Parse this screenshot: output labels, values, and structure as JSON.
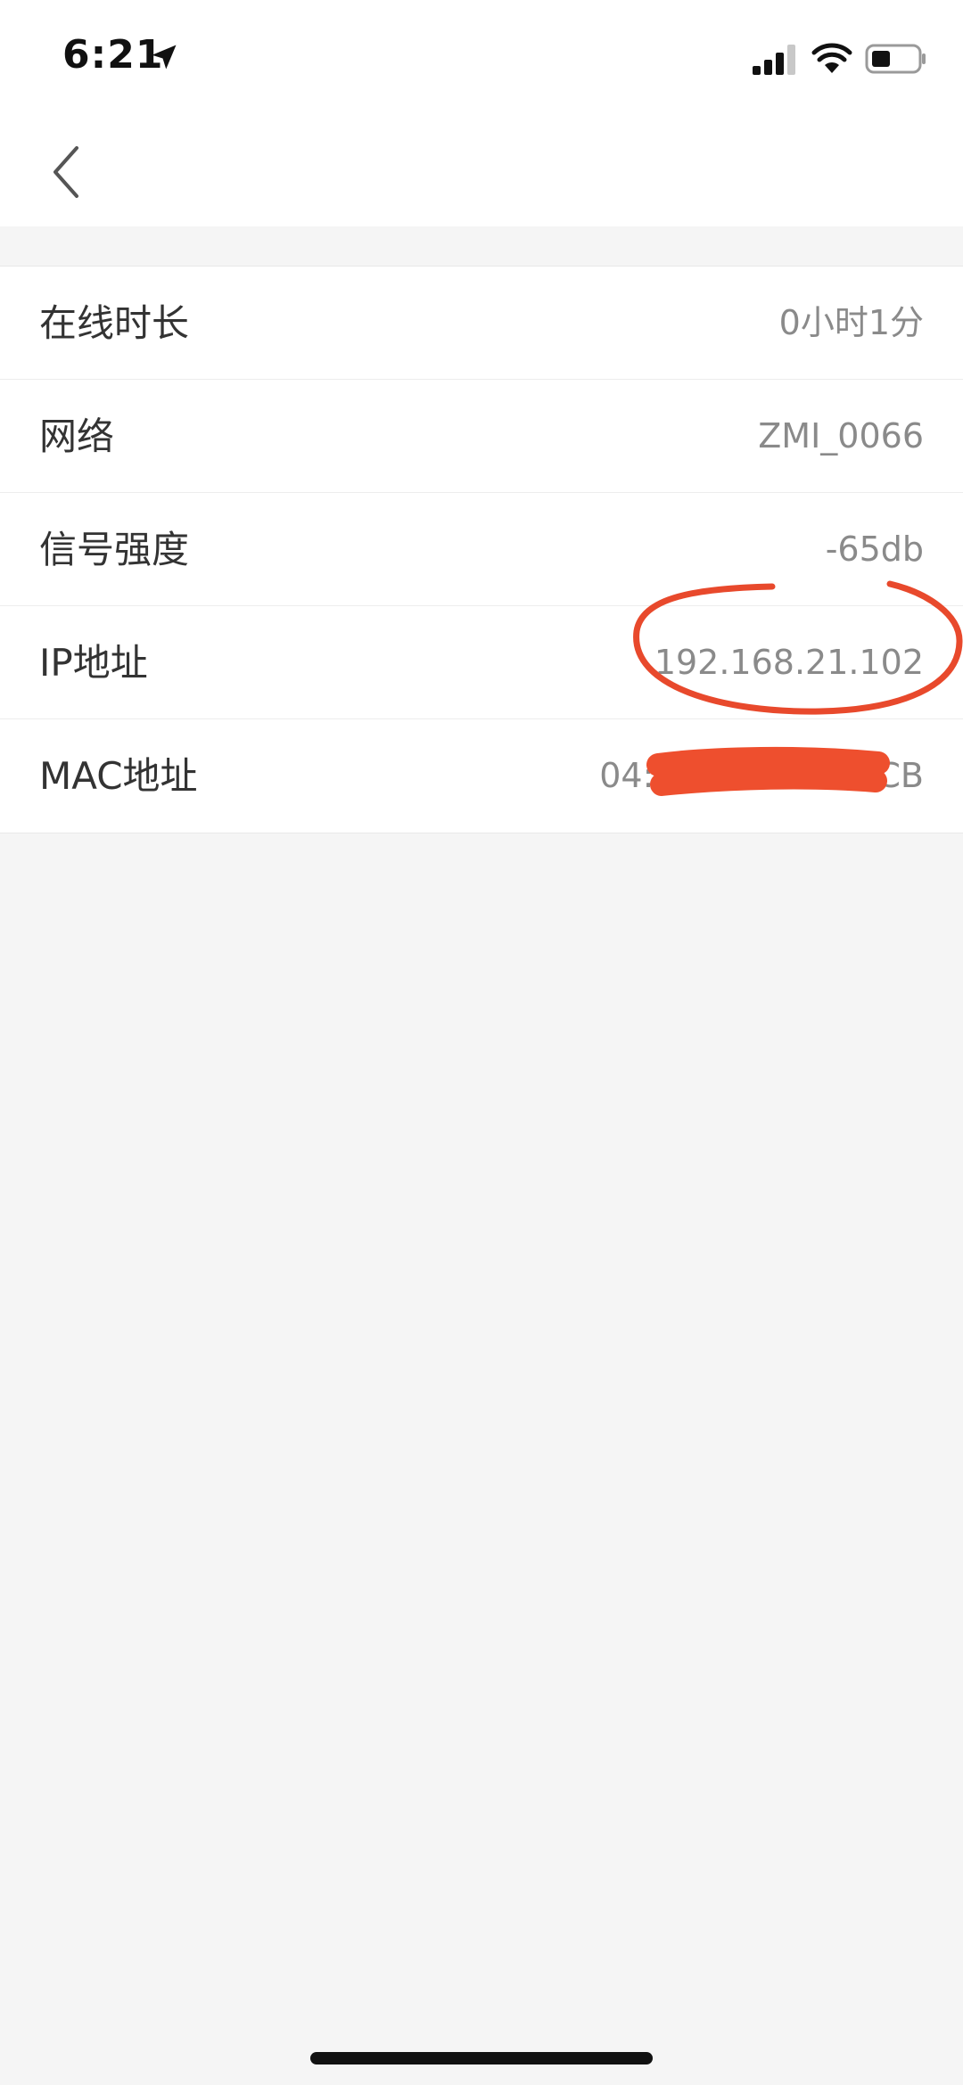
{
  "status_bar": {
    "time": "6:21",
    "icons": [
      "location-arrow-icon",
      "cellular-signal-icon",
      "wifi-icon",
      "battery-icon"
    ]
  },
  "nav": {
    "back_icon": "chevron-left-icon"
  },
  "details": [
    {
      "label": "在线时长",
      "value": "0小时1分"
    },
    {
      "label": "网络",
      "value": "ZMI_0066"
    },
    {
      "label": "信号强度",
      "value": "-65db"
    },
    {
      "label": "IP地址",
      "value": "192.168.21.102"
    },
    {
      "label": "MAC地址",
      "value": "04:"
    }
  ],
  "mac_suffix": "CB",
  "annotations": {
    "circle_color": "#e8492c",
    "redaction_color": "#ee4f2e"
  },
  "colors": {
    "background": "#f5f5f5",
    "card": "#ffffff",
    "label_text": "#333333",
    "value_text": "#8a8a8a"
  }
}
